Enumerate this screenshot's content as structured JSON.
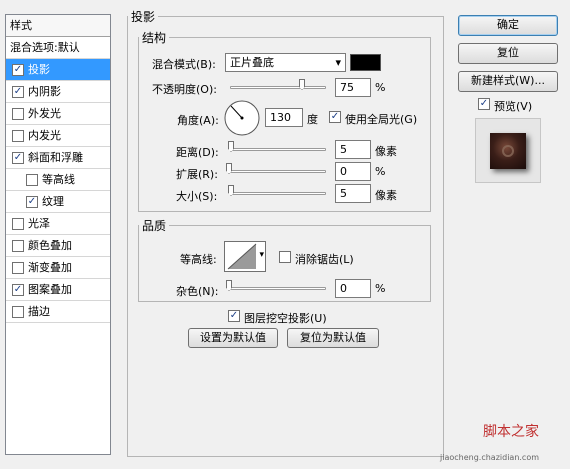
{
  "sidebar": {
    "header": "样式",
    "items": [
      {
        "label": "混合选项:默认",
        "checkbox": false,
        "checked": false,
        "sub": false,
        "selected": false
      },
      {
        "label": "投影",
        "checkbox": true,
        "checked": true,
        "sub": false,
        "selected": true
      },
      {
        "label": "内阴影",
        "checkbox": true,
        "checked": true,
        "sub": false,
        "selected": false
      },
      {
        "label": "外发光",
        "checkbox": true,
        "checked": false,
        "sub": false,
        "selected": false
      },
      {
        "label": "内发光",
        "checkbox": true,
        "checked": false,
        "sub": false,
        "selected": false
      },
      {
        "label": "斜面和浮雕",
        "checkbox": true,
        "checked": true,
        "sub": false,
        "selected": false
      },
      {
        "label": "等高线",
        "checkbox": true,
        "checked": false,
        "sub": true,
        "selected": false
      },
      {
        "label": "纹理",
        "checkbox": true,
        "checked": true,
        "sub": true,
        "selected": false
      },
      {
        "label": "光泽",
        "checkbox": true,
        "checked": false,
        "sub": false,
        "selected": false
      },
      {
        "label": "颜色叠加",
        "checkbox": true,
        "checked": false,
        "sub": false,
        "selected": false
      },
      {
        "label": "渐变叠加",
        "checkbox": true,
        "checked": false,
        "sub": false,
        "selected": false
      },
      {
        "label": "图案叠加",
        "checkbox": true,
        "checked": true,
        "sub": false,
        "selected": false
      },
      {
        "label": "描边",
        "checkbox": true,
        "checked": false,
        "sub": false,
        "selected": false
      }
    ]
  },
  "panel": {
    "title": "投影",
    "structure": {
      "title": "结构",
      "blend_mode_label": "混合模式(B):",
      "blend_mode_value": "正片叠底",
      "shadow_color": "#000000",
      "opacity_label": "不透明度(O):",
      "opacity_value": "75",
      "opacity_unit": "%",
      "opacity_fraction": 0.75,
      "angle_label": "角度(A):",
      "angle_value": "130",
      "angle_unit": "度",
      "global_light_label": "使用全局光(G)",
      "global_light_checked": true,
      "distance_label": "距离(D):",
      "distance_value": "5",
      "distance_unit": "像素",
      "spread_label": "扩展(R):",
      "spread_value": "0",
      "spread_unit": "%",
      "size_label": "大小(S):",
      "size_value": "5",
      "size_unit": "像素"
    },
    "quality": {
      "title": "品质",
      "contour_label": "等高线:",
      "antialias_label": "消除锯齿(L)",
      "antialias_checked": false,
      "noise_label": "杂色(N):",
      "noise_value": "0",
      "noise_unit": "%"
    },
    "knockout_label": "图层挖空投影(U)",
    "knockout_checked": true,
    "make_default_label": "设置为默认值",
    "reset_default_label": "复位为默认值"
  },
  "buttons": {
    "ok": "确定",
    "reset": "复位",
    "new_style": "新建样式(W)...",
    "preview_label": "预览(V)",
    "preview_checked": true
  },
  "watermark": {
    "brand": "脚本之家",
    "url": "jiaocheng.chazidian.com"
  },
  "icons": {
    "checkmark": "✓",
    "dropdown_arrow": "▾"
  }
}
